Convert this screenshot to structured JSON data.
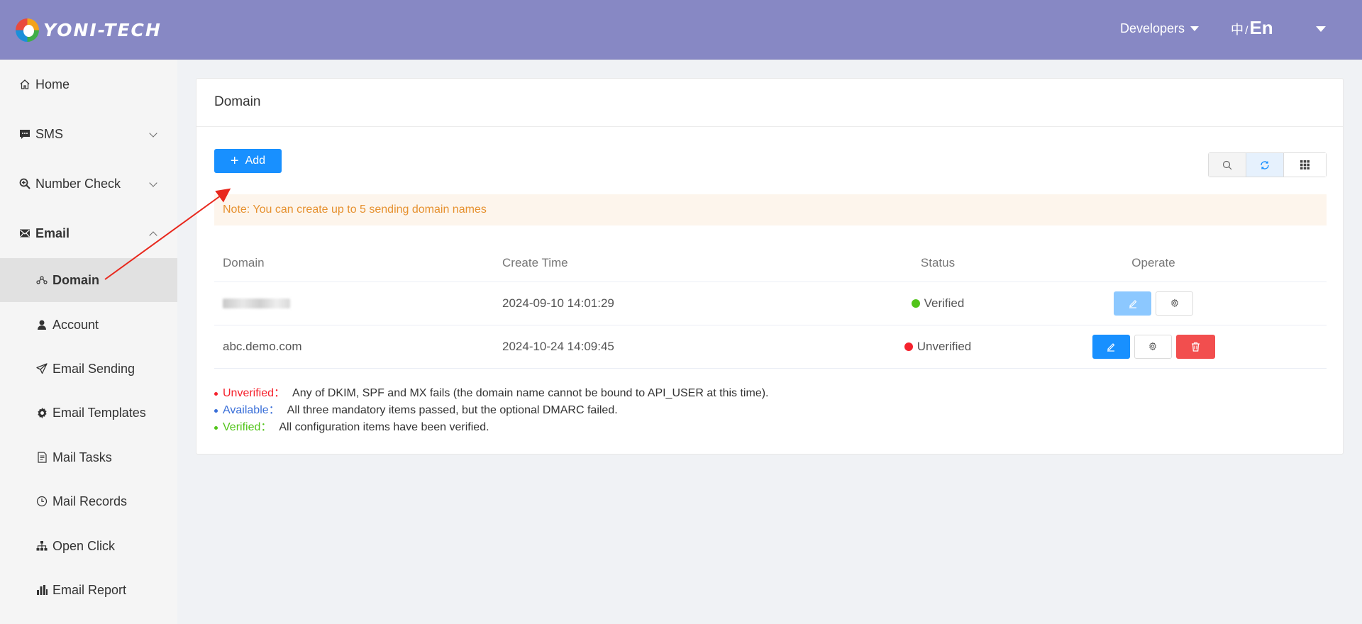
{
  "header": {
    "brand": "YONI-TECH",
    "developers_label": "Developers",
    "lang_zh": "中",
    "lang_sep": "/",
    "lang_en": "En",
    "bg_color": "#8788c4"
  },
  "sidebar": {
    "items": [
      {
        "label": "Home",
        "icon": "home-icon"
      },
      {
        "label": "SMS",
        "icon": "message-icon"
      },
      {
        "label": "Number Check",
        "icon": "zoom-check-icon"
      },
      {
        "label": "Email",
        "icon": "mail-icon"
      },
      {
        "label": "Domain",
        "icon": "link-nodes-icon"
      },
      {
        "label": "Account",
        "icon": "user-icon"
      },
      {
        "label": "Email Sending",
        "icon": "send-icon"
      },
      {
        "label": "Email Templates",
        "icon": "gear-icon"
      },
      {
        "label": "Mail Tasks",
        "icon": "task-doc-icon"
      },
      {
        "label": "Mail Records",
        "icon": "clock-icon"
      },
      {
        "label": "Open Click",
        "icon": "hierarchy-icon"
      },
      {
        "label": "Email Report",
        "icon": "bar-chart-icon"
      }
    ]
  },
  "main": {
    "title": "Domain",
    "add_label": "Add",
    "note": "Note: You can create up to 5 sending domain names",
    "columns": [
      "Domain",
      "Create Time",
      "Status",
      "Operate"
    ],
    "rows": [
      {
        "domain": "",
        "create_time": "2024-09-10 14:01:29",
        "status": "Verified",
        "status_color": "#52c41a"
      },
      {
        "domain": "abc.demo.com",
        "create_time": "2024-10-24 14:09:45",
        "status": "Unverified",
        "status_color": "#f5222d"
      }
    ],
    "legend": [
      {
        "label": "Unverified：",
        "text": "Any of DKIM, SPF and MX fails (the domain name cannot be bound to API_USER at this time).",
        "color": "#f5222d"
      },
      {
        "label": "Available：",
        "text": "All three mandatory items passed, but the optional DMARC failed.",
        "color": "#3a6fd8"
      },
      {
        "label": "Verified：",
        "text": "All configuration items have been verified.",
        "color": "#52c41a"
      }
    ]
  },
  "colors": {
    "primary": "#1890ff",
    "danger": "#f24e4e",
    "note_text": "#e6912f",
    "note_bg": "#fdf5ec"
  }
}
